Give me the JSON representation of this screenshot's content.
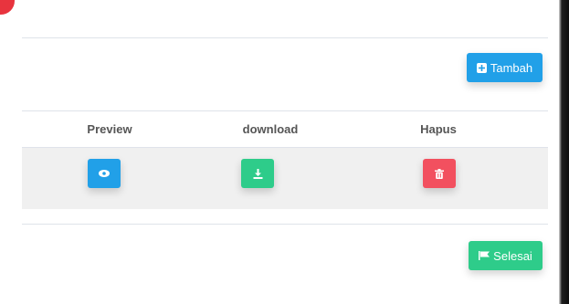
{
  "top_actions": {
    "add_label": "Tambah"
  },
  "table": {
    "headers": [
      "Preview",
      "download",
      "Hapus"
    ]
  },
  "bottom_actions": {
    "finish_label": "Selesai"
  },
  "icons": {
    "add": "plus-square-icon",
    "preview": "eye-icon",
    "download": "download-icon",
    "delete": "trash-icon",
    "finish": "flag-icon"
  },
  "colors": {
    "primary": "#21a0e8",
    "success": "#2ecc8a",
    "danger": "#f2505f"
  }
}
